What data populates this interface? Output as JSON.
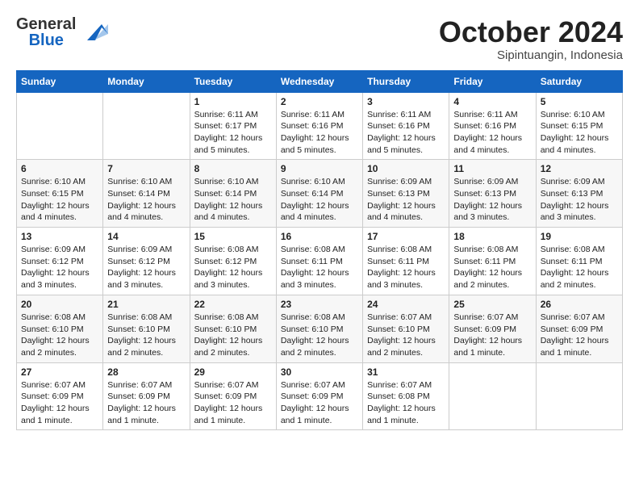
{
  "header": {
    "logo_line1": "General",
    "logo_line2": "Blue",
    "month": "October 2024",
    "location": "Sipintuangin, Indonesia"
  },
  "days_of_week": [
    "Sunday",
    "Monday",
    "Tuesday",
    "Wednesday",
    "Thursday",
    "Friday",
    "Saturday"
  ],
  "weeks": [
    [
      {
        "day": "",
        "info": ""
      },
      {
        "day": "",
        "info": ""
      },
      {
        "day": "1",
        "info": "Sunrise: 6:11 AM\nSunset: 6:17 PM\nDaylight: 12 hours\nand 5 minutes."
      },
      {
        "day": "2",
        "info": "Sunrise: 6:11 AM\nSunset: 6:16 PM\nDaylight: 12 hours\nand 5 minutes."
      },
      {
        "day": "3",
        "info": "Sunrise: 6:11 AM\nSunset: 6:16 PM\nDaylight: 12 hours\nand 5 minutes."
      },
      {
        "day": "4",
        "info": "Sunrise: 6:11 AM\nSunset: 6:16 PM\nDaylight: 12 hours\nand 4 minutes."
      },
      {
        "day": "5",
        "info": "Sunrise: 6:10 AM\nSunset: 6:15 PM\nDaylight: 12 hours\nand 4 minutes."
      }
    ],
    [
      {
        "day": "6",
        "info": "Sunrise: 6:10 AM\nSunset: 6:15 PM\nDaylight: 12 hours\nand 4 minutes."
      },
      {
        "day": "7",
        "info": "Sunrise: 6:10 AM\nSunset: 6:14 PM\nDaylight: 12 hours\nand 4 minutes."
      },
      {
        "day": "8",
        "info": "Sunrise: 6:10 AM\nSunset: 6:14 PM\nDaylight: 12 hours\nand 4 minutes."
      },
      {
        "day": "9",
        "info": "Sunrise: 6:10 AM\nSunset: 6:14 PM\nDaylight: 12 hours\nand 4 minutes."
      },
      {
        "day": "10",
        "info": "Sunrise: 6:09 AM\nSunset: 6:13 PM\nDaylight: 12 hours\nand 4 minutes."
      },
      {
        "day": "11",
        "info": "Sunrise: 6:09 AM\nSunset: 6:13 PM\nDaylight: 12 hours\nand 3 minutes."
      },
      {
        "day": "12",
        "info": "Sunrise: 6:09 AM\nSunset: 6:13 PM\nDaylight: 12 hours\nand 3 minutes."
      }
    ],
    [
      {
        "day": "13",
        "info": "Sunrise: 6:09 AM\nSunset: 6:12 PM\nDaylight: 12 hours\nand 3 minutes."
      },
      {
        "day": "14",
        "info": "Sunrise: 6:09 AM\nSunset: 6:12 PM\nDaylight: 12 hours\nand 3 minutes."
      },
      {
        "day": "15",
        "info": "Sunrise: 6:08 AM\nSunset: 6:12 PM\nDaylight: 12 hours\nand 3 minutes."
      },
      {
        "day": "16",
        "info": "Sunrise: 6:08 AM\nSunset: 6:11 PM\nDaylight: 12 hours\nand 3 minutes."
      },
      {
        "day": "17",
        "info": "Sunrise: 6:08 AM\nSunset: 6:11 PM\nDaylight: 12 hours\nand 3 minutes."
      },
      {
        "day": "18",
        "info": "Sunrise: 6:08 AM\nSunset: 6:11 PM\nDaylight: 12 hours\nand 2 minutes."
      },
      {
        "day": "19",
        "info": "Sunrise: 6:08 AM\nSunset: 6:11 PM\nDaylight: 12 hours\nand 2 minutes."
      }
    ],
    [
      {
        "day": "20",
        "info": "Sunrise: 6:08 AM\nSunset: 6:10 PM\nDaylight: 12 hours\nand 2 minutes."
      },
      {
        "day": "21",
        "info": "Sunrise: 6:08 AM\nSunset: 6:10 PM\nDaylight: 12 hours\nand 2 minutes."
      },
      {
        "day": "22",
        "info": "Sunrise: 6:08 AM\nSunset: 6:10 PM\nDaylight: 12 hours\nand 2 minutes."
      },
      {
        "day": "23",
        "info": "Sunrise: 6:08 AM\nSunset: 6:10 PM\nDaylight: 12 hours\nand 2 minutes."
      },
      {
        "day": "24",
        "info": "Sunrise: 6:07 AM\nSunset: 6:10 PM\nDaylight: 12 hours\nand 2 minutes."
      },
      {
        "day": "25",
        "info": "Sunrise: 6:07 AM\nSunset: 6:09 PM\nDaylight: 12 hours\nand 1 minute."
      },
      {
        "day": "26",
        "info": "Sunrise: 6:07 AM\nSunset: 6:09 PM\nDaylight: 12 hours\nand 1 minute."
      }
    ],
    [
      {
        "day": "27",
        "info": "Sunrise: 6:07 AM\nSunset: 6:09 PM\nDaylight: 12 hours\nand 1 minute."
      },
      {
        "day": "28",
        "info": "Sunrise: 6:07 AM\nSunset: 6:09 PM\nDaylight: 12 hours\nand 1 minute."
      },
      {
        "day": "29",
        "info": "Sunrise: 6:07 AM\nSunset: 6:09 PM\nDaylight: 12 hours\nand 1 minute."
      },
      {
        "day": "30",
        "info": "Sunrise: 6:07 AM\nSunset: 6:09 PM\nDaylight: 12 hours\nand 1 minute."
      },
      {
        "day": "31",
        "info": "Sunrise: 6:07 AM\nSunset: 6:08 PM\nDaylight: 12 hours\nand 1 minute."
      },
      {
        "day": "",
        "info": ""
      },
      {
        "day": "",
        "info": ""
      }
    ]
  ]
}
